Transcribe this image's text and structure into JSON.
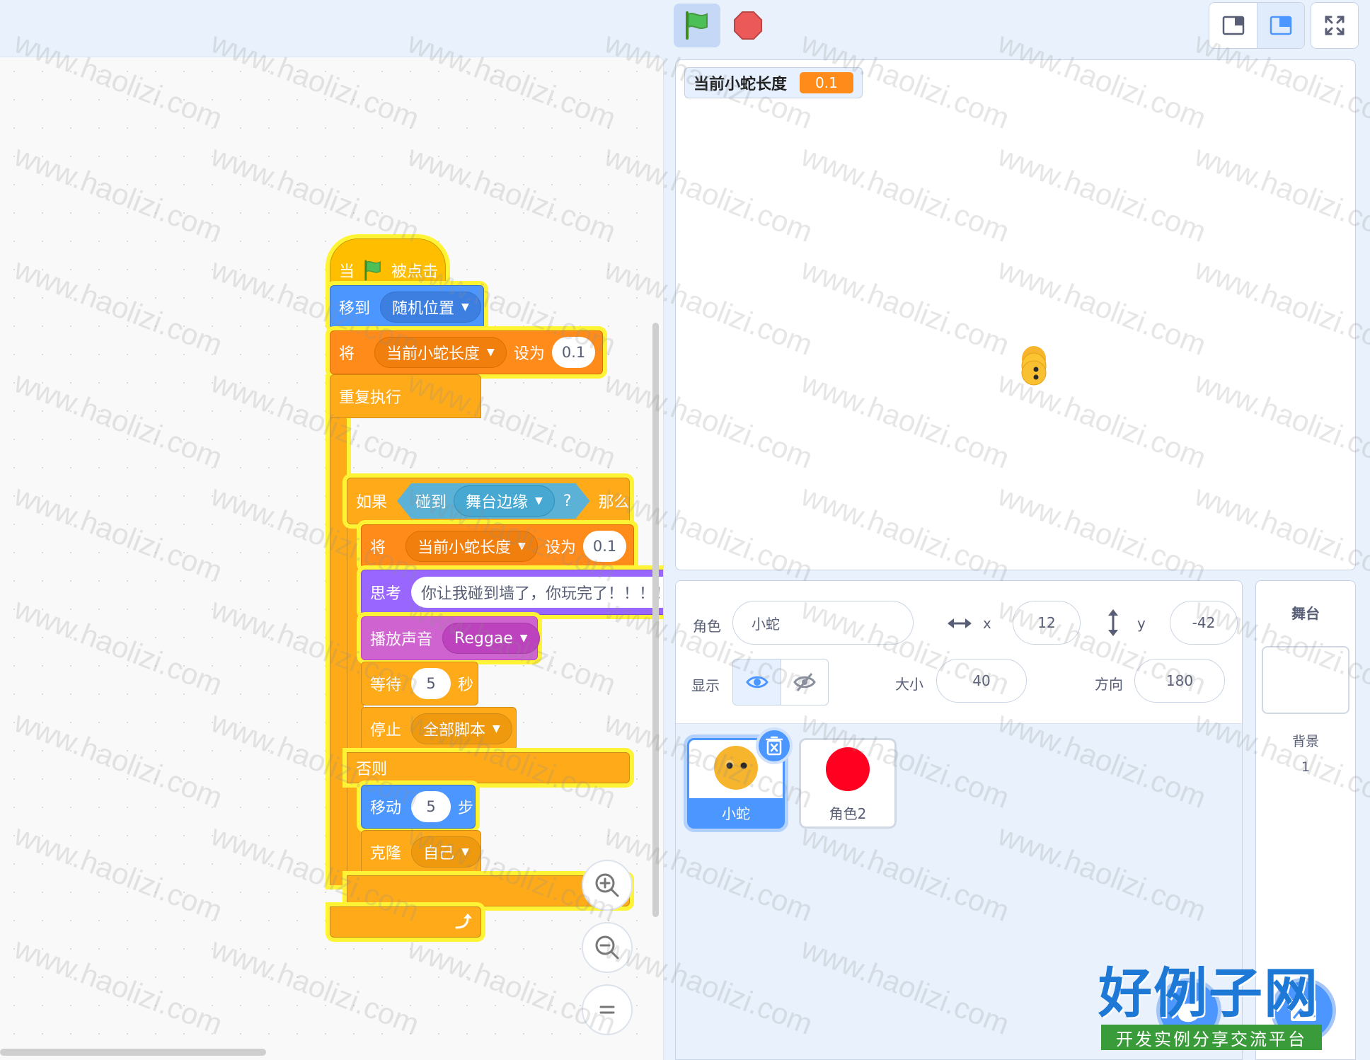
{
  "toolbar": {
    "green_flag_icon": "green-flag-icon",
    "stop_icon": "stop-icon",
    "layout_small_icon": "small-stage-layout-icon",
    "layout_normal_icon": "normal-stage-layout-icon",
    "fullscreen_icon": "fullscreen-icon"
  },
  "script": {
    "hat": {
      "when": "当",
      "clicked": "被点击"
    },
    "goto": {
      "label": "移到",
      "target": "随机位置"
    },
    "set1": {
      "label": "将",
      "variable": "当前小蛇长度",
      "to": "设为",
      "value": "0.1"
    },
    "forever": {
      "label": "重复执行"
    },
    "if": {
      "label": "如果",
      "then": "那么"
    },
    "touching": {
      "label": "碰到",
      "target": "舞台边缘",
      "q": "?"
    },
    "set2": {
      "label": "将",
      "variable": "当前小蛇长度",
      "to": "设为",
      "value": "0.1"
    },
    "think": {
      "label": "思考",
      "text": "你让我碰到墙了，你玩完了！！！！"
    },
    "play": {
      "label": "播放声音",
      "sound": "Reggae"
    },
    "wait": {
      "label": "等待",
      "value": "5",
      "unit": "秒"
    },
    "stop": {
      "label": "停止",
      "option": "全部脚本"
    },
    "else": {
      "label": "否则"
    },
    "move": {
      "label": "移动",
      "value": "5",
      "unit": "步"
    },
    "clone": {
      "label": "克隆",
      "target": "自己"
    }
  },
  "zoom": {
    "in_icon": "zoom-in-icon",
    "out_icon": "zoom-out-icon",
    "reset_icon": "zoom-reset-icon"
  },
  "stage": {
    "monitor": {
      "label": "当前小蛇长度",
      "value": "0.1"
    }
  },
  "sprite_info": {
    "sprite_label": "角色",
    "sprite_name": "小蛇",
    "x_label": "x",
    "x_value": "12",
    "y_label": "y",
    "y_value": "-42",
    "show_label": "显示",
    "size_label": "大小",
    "size_value": "40",
    "direction_label": "方向",
    "direction_value": "180"
  },
  "sprites": [
    {
      "name": "小蛇",
      "selected": true
    },
    {
      "name": "角色2",
      "selected": false
    }
  ],
  "stage_pane": {
    "title": "舞台",
    "backdrops_label": "背景",
    "backdrops_count": "1"
  },
  "colors": {
    "events": "#ffbf00",
    "motion": "#4c97ff",
    "variables": "#ff8c1a",
    "control": "#ffab19",
    "looks": "#9966ff",
    "sound": "#cf63cf",
    "sensing": "#5cb1d6",
    "glow": "#fff335"
  },
  "watermark": {
    "text": "www.haolizi.com",
    "logo": "好例子网",
    "logo_sub": "开发实例分享交流平台"
  }
}
